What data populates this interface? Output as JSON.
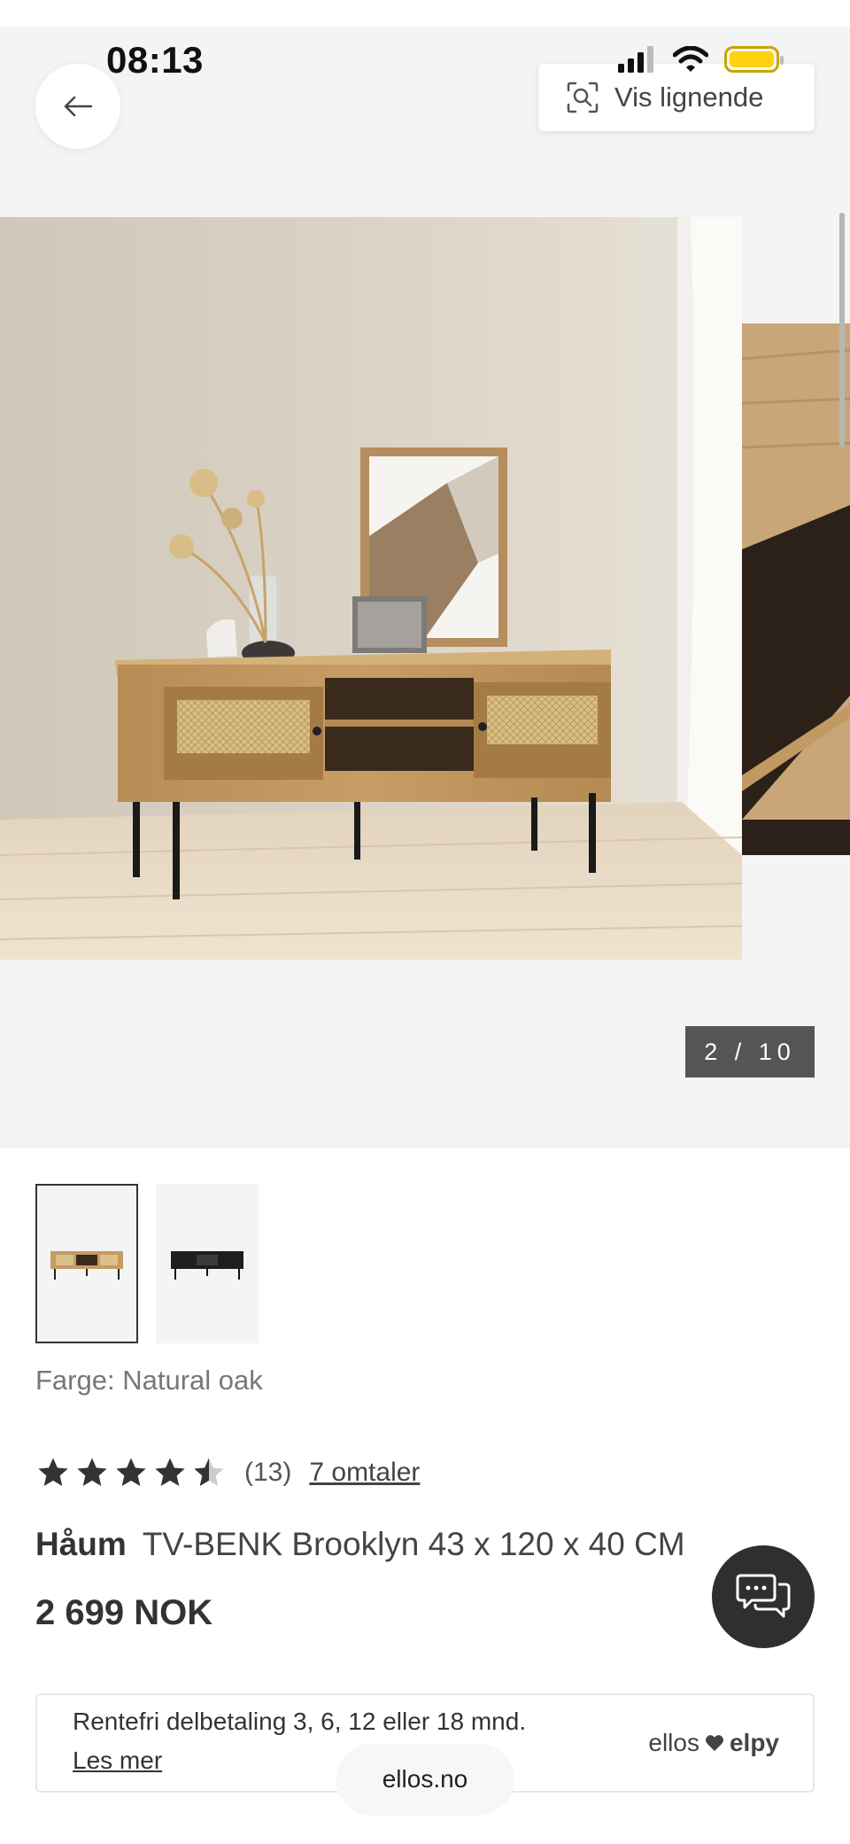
{
  "status_bar": {
    "time": "08:13"
  },
  "header": {
    "similar_label": "Vis lignende"
  },
  "gallery": {
    "counter": "2 / 10"
  },
  "product": {
    "color_line": "Farge: Natural oak",
    "rating": {
      "stars": 4.5,
      "count_label": "(13)",
      "reviews_link": "7 omtaler"
    },
    "brand": "Håum",
    "name": "TV-BENK Brooklyn 43 x 120 x 40 CM",
    "price": "2 699 NOK"
  },
  "payment": {
    "text": "Rentefri delbetaling 3, 6, 12 eller 18 mnd.",
    "link": "Les mer",
    "partner_1": "ellos",
    "partner_2": "elpy"
  },
  "browser": {
    "url": "ellos.no"
  },
  "icons": {
    "back": "arrow-left-icon",
    "similar": "visual-search-icon",
    "chat": "chat-bubbles-icon"
  },
  "colors": {
    "accent": "#333333",
    "battery": "#ffd10f",
    "gallery_bg": "#f4f4f4"
  }
}
